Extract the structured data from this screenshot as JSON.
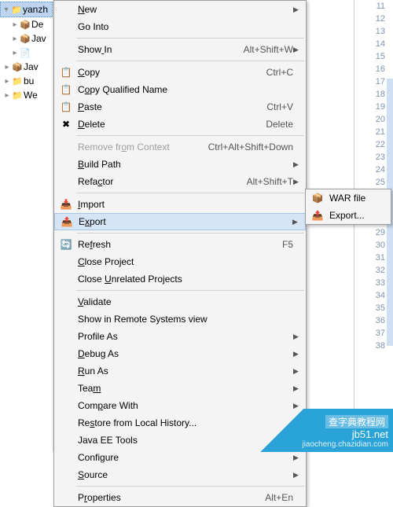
{
  "tree": {
    "root_label": "yanzh",
    "items": [
      {
        "icon": "📦",
        "label": "De"
      },
      {
        "icon": "📦",
        "label": "Jav"
      },
      {
        "icon": "📄",
        "label": ""
      },
      {
        "icon": "📦",
        "label": "Jav"
      },
      {
        "icon": "📁",
        "label": "bu"
      },
      {
        "icon": "📁",
        "label": "We"
      }
    ]
  },
  "menu": {
    "items": [
      {
        "label": "New",
        "u": 0,
        "arrow": true
      },
      {
        "label": "Go Into"
      },
      {
        "sep": true
      },
      {
        "label": "Show In",
        "u": 4,
        "shortcut": "Alt+Shift+W",
        "arrow": true
      },
      {
        "sep": true
      },
      {
        "icon": "📋",
        "label": "Copy",
        "u": 0,
        "shortcut": "Ctrl+C"
      },
      {
        "icon": "📋",
        "label": "Copy Qualified Name",
        "u": 1
      },
      {
        "icon": "📋",
        "label": "Paste",
        "u": 0,
        "shortcut": "Ctrl+V"
      },
      {
        "icon": "✖",
        "label": "Delete",
        "u": 0,
        "shortcut": "Delete"
      },
      {
        "sep": true
      },
      {
        "label": "Remove from Context",
        "u": 9,
        "shortcut": "Ctrl+Alt+Shift+Down",
        "disabled": true
      },
      {
        "label": "Build Path",
        "u": 0,
        "arrow": true
      },
      {
        "label": "Refactor",
        "u": 4,
        "shortcut": "Alt+Shift+T",
        "arrow": true
      },
      {
        "sep": true
      },
      {
        "icon": "📥",
        "label": "Import",
        "u": 0
      },
      {
        "icon": "📤",
        "label": "Export",
        "u": 1,
        "arrow": true,
        "highlight": true
      },
      {
        "sep": true
      },
      {
        "icon": "🔄",
        "label": "Refresh",
        "u": 2,
        "shortcut": "F5"
      },
      {
        "label": "Close Project",
        "u": 0
      },
      {
        "label": "Close Unrelated Projects",
        "u": 6
      },
      {
        "sep": true
      },
      {
        "label": "Validate",
        "u": 0
      },
      {
        "label": "Show in Remote Systems view"
      },
      {
        "label": "Profile As",
        "arrow": true
      },
      {
        "label": "Debug As",
        "u": 0,
        "arrow": true
      },
      {
        "label": "Run As",
        "u": 0,
        "arrow": true
      },
      {
        "label": "Team",
        "u": 3,
        "arrow": true
      },
      {
        "label": "Compare With",
        "u": 3,
        "arrow": true
      },
      {
        "label": "Restore from Local History...",
        "u": 2
      },
      {
        "label": "Java EE Tools",
        "arrow": true
      },
      {
        "label": "Configure",
        "u": 5,
        "arrow": true
      },
      {
        "label": "Source",
        "u": 0,
        "arrow": true
      },
      {
        "sep": true
      },
      {
        "label": "Properties",
        "u": 1,
        "shortcut": "Alt+En"
      }
    ]
  },
  "submenu": {
    "items": [
      {
        "icon": "📦",
        "label": "WAR file"
      },
      {
        "icon": "📤",
        "label": "Export..."
      }
    ]
  },
  "gutter": {
    "start": 11,
    "end": 38
  },
  "watermark": {
    "line1": "jb51.net",
    "line2": "jiaocheng.chazidian.com",
    "badge": "查字典教程网"
  }
}
